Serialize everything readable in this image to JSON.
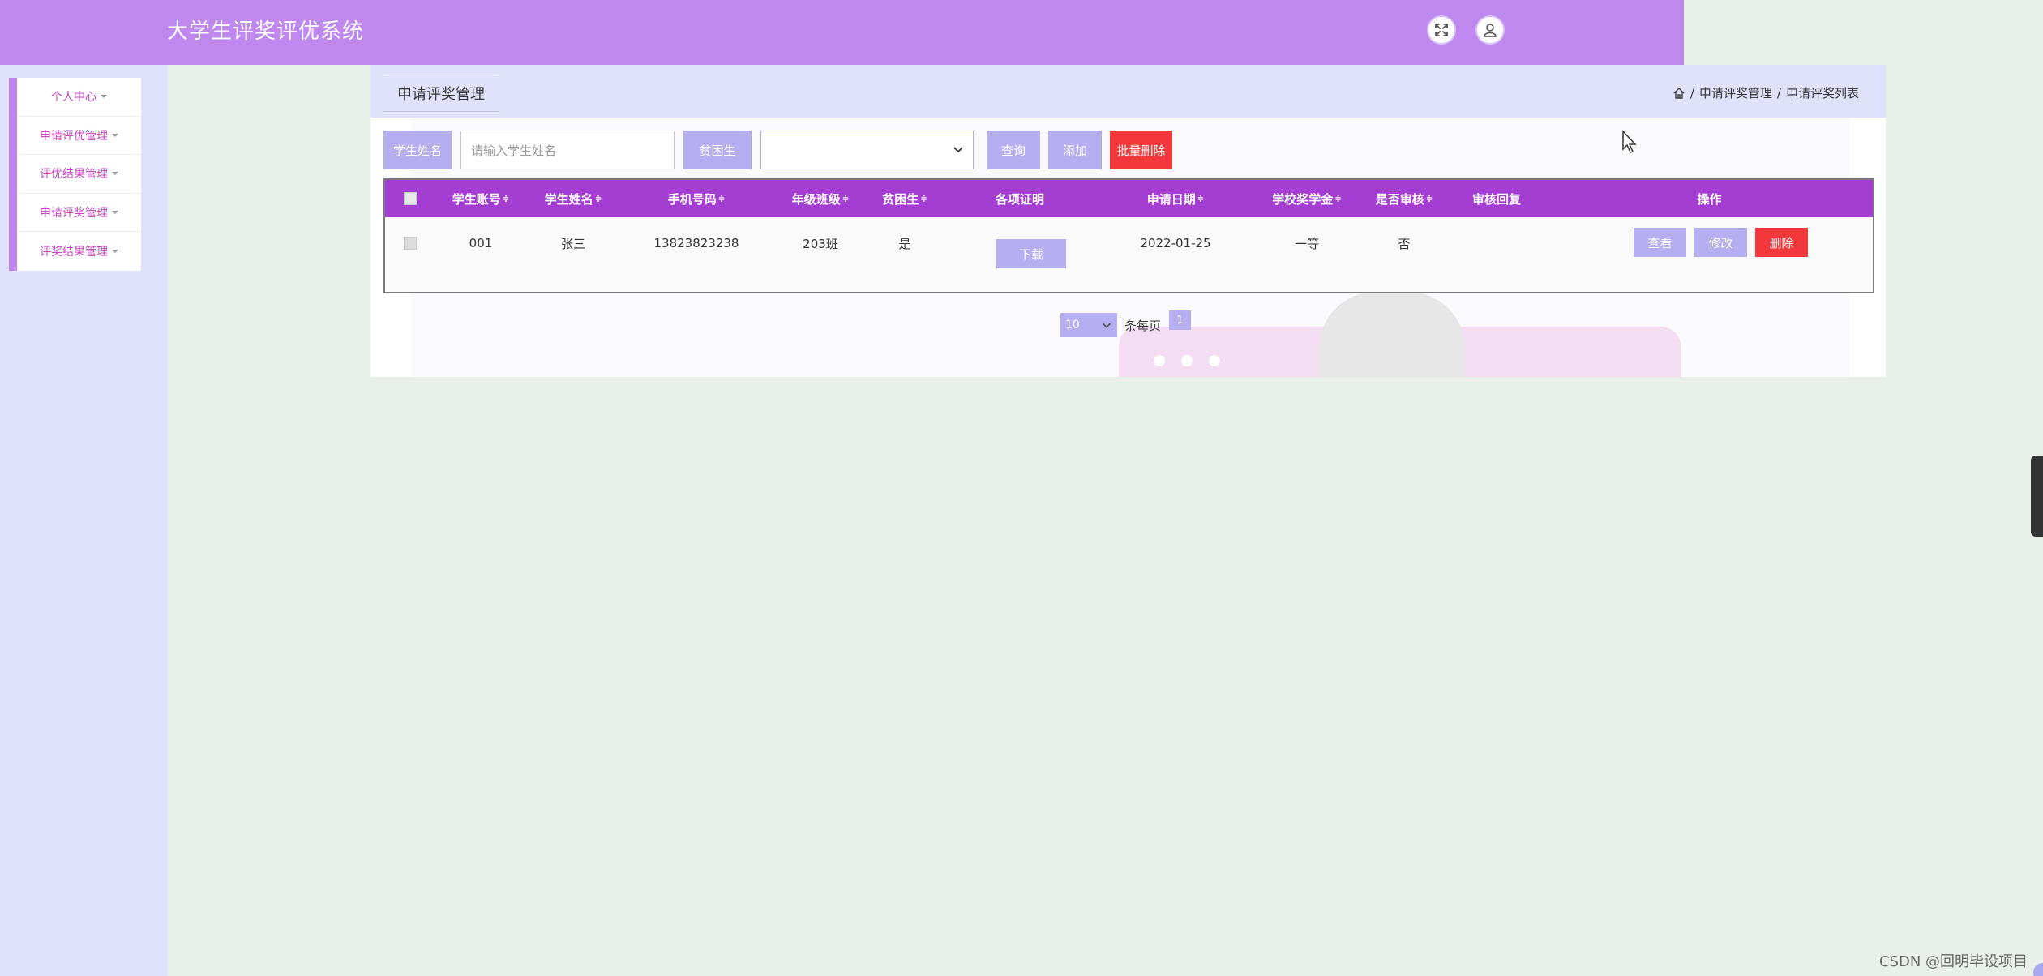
{
  "app": {
    "title": "大学生评奖评优系统"
  },
  "header": {
    "icons": [
      "fullscreen-icon",
      "user-icon"
    ]
  },
  "sidebar": {
    "items": [
      {
        "label": "个人中心"
      },
      {
        "label": "申请评优管理"
      },
      {
        "label": "评优结果管理"
      },
      {
        "label": "申请评奖管理"
      },
      {
        "label": "评奖结果管理"
      }
    ]
  },
  "main": {
    "tab_label": "申请评奖管理",
    "breadcrumb": {
      "separator": "/",
      "items": [
        "申请评奖管理",
        "申请评奖列表"
      ]
    },
    "search": {
      "name_label": "学生姓名",
      "name_placeholder": "请输入学生姓名",
      "name_value": "",
      "poor_label": "贫困生",
      "poor_value": "",
      "query_label": "查询",
      "add_label": "添加",
      "batch_delete_label": "批量删除"
    },
    "table": {
      "sort_glyph": "≑",
      "columns": [
        {
          "label": "学生账号",
          "sortable": true
        },
        {
          "label": "学生姓名",
          "sortable": true
        },
        {
          "label": "手机号码",
          "sortable": true
        },
        {
          "label": "年级班级",
          "sortable": true
        },
        {
          "label": "贫困生",
          "sortable": true
        },
        {
          "label": "各项证明",
          "sortable": false
        },
        {
          "label": "申请日期",
          "sortable": true
        },
        {
          "label": "学校奖学金",
          "sortable": true
        },
        {
          "label": "是否审核",
          "sortable": true
        },
        {
          "label": "审核回复",
          "sortable": false
        },
        {
          "label": "操作",
          "sortable": false
        }
      ],
      "rows": [
        {
          "account": "001",
          "name": "张三",
          "phone": "13823823238",
          "class": "203班",
          "poor": "是",
          "proof_button": "下载",
          "date": "2022-01-25",
          "scholarship": "一等",
          "reviewed": "否",
          "review_reply": "",
          "actions": {
            "view": "查看",
            "edit": "修改",
            "delete": "删除"
          }
        }
      ]
    },
    "pagination": {
      "page_size": "10",
      "per_page_label": "条每页",
      "current_page": "1"
    }
  },
  "colors": {
    "header": "#bf88ef",
    "table_header": "#a43dd1",
    "button_purple": "#b5aef0",
    "button_red": "#f2383b",
    "sidebar_text": "#c845c2",
    "page_bg": "#e8f0e9",
    "sidebar_bg": "#e0e2fb"
  },
  "watermark": "CSDN @回明毕设项目"
}
